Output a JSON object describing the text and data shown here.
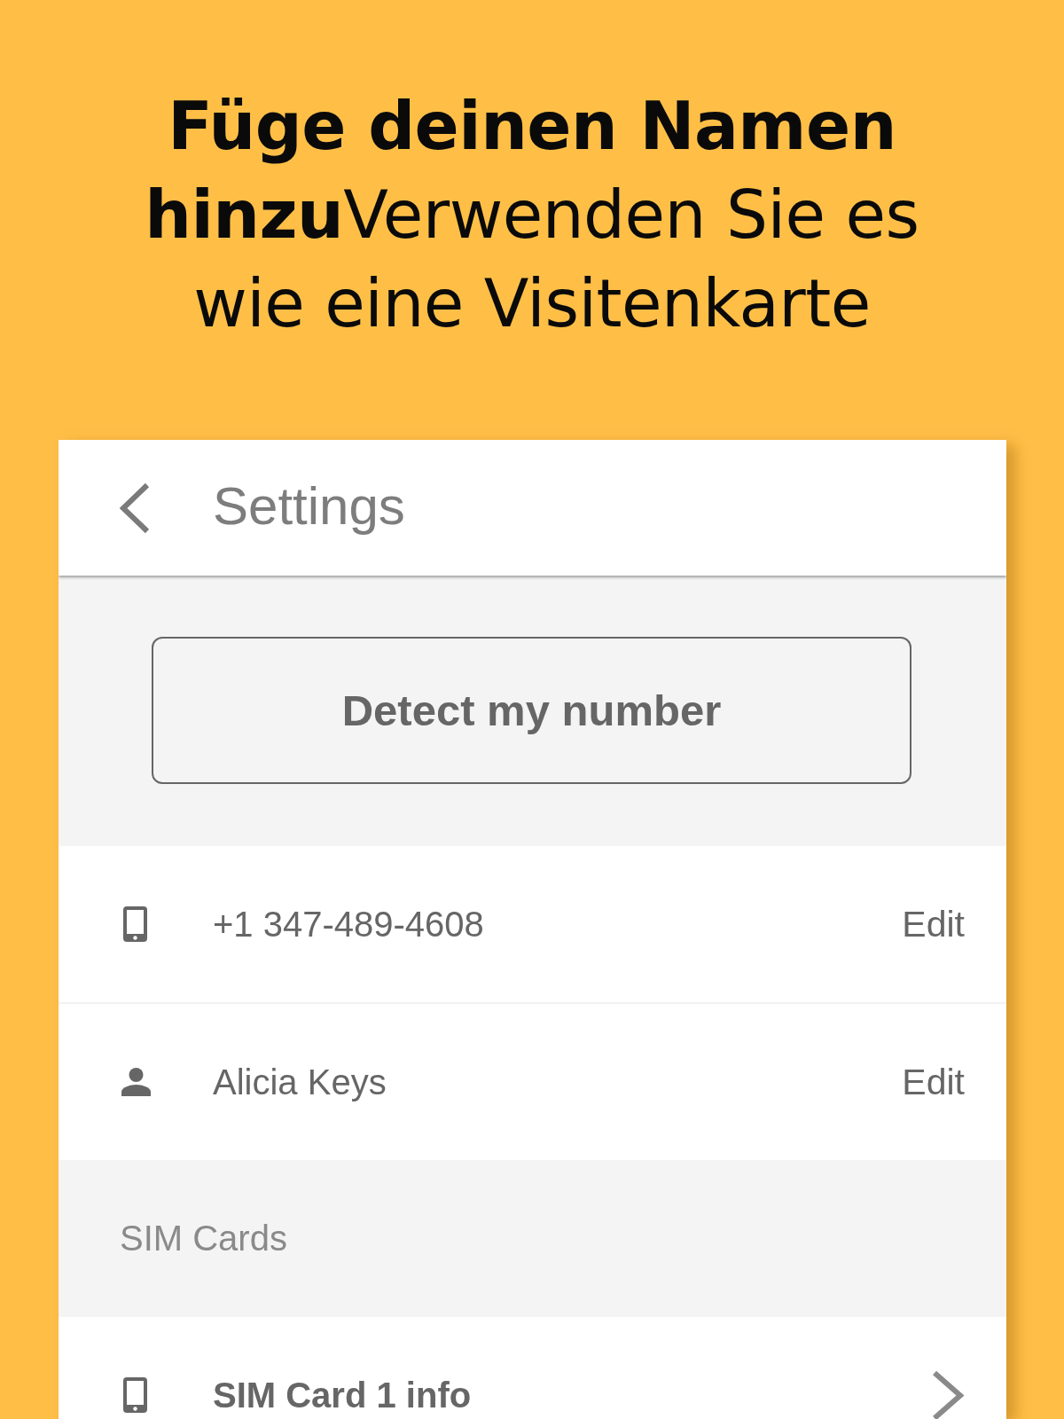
{
  "headline": "**Füge deinen Namen hinzu**Verwenden Sie es wie eine Visitenkarte",
  "app_bar": {
    "title": "Settings"
  },
  "detect_button": {
    "label": "Detect my number"
  },
  "rows": [
    {
      "kind": "number",
      "text": "+1 347-489-4608",
      "action": "Edit"
    },
    {
      "kind": "name",
      "text": "Alicia Keys",
      "action": "Edit"
    }
  ],
  "sections": [
    {
      "title": "SIM Cards",
      "items": [
        {
          "kind": "sim",
          "text": "SIM Card 1 info"
        }
      ]
    }
  ]
}
